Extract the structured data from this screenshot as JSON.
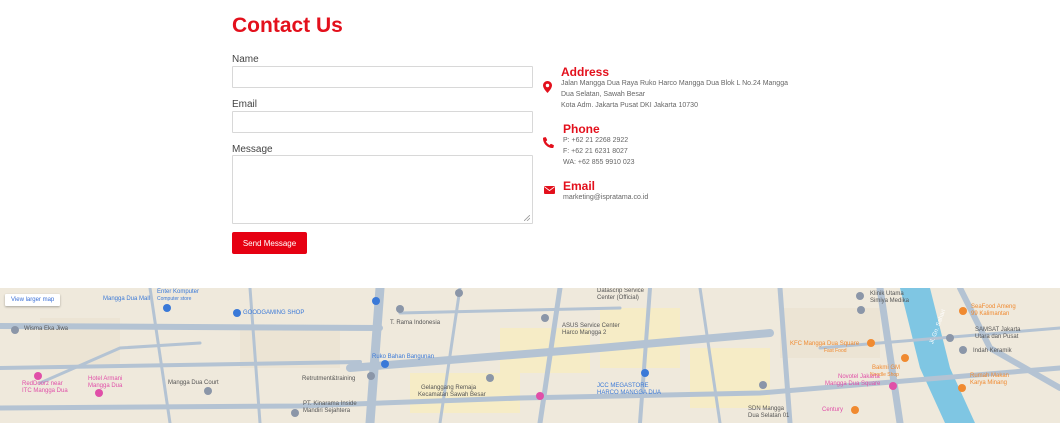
{
  "contact": {
    "title": "Contact Us",
    "name_label": "Name",
    "email_label": "Email",
    "message_label": "Message",
    "send_label": "Send Message"
  },
  "info": {
    "address": {
      "title": "Address",
      "lines": [
        "Jalan Mangga Dua Raya Ruko Harco Mangga Dua Blok L No.24 Mangga",
        "Dua Selatan, Sawah Besar",
        "Kota Adm. Jakarta Pusat DKI Jakarta 10730"
      ],
      "icon": "map-marker-icon"
    },
    "phone": {
      "title": "Phone",
      "lines": [
        "P: +62 21 2268 2922",
        "F: +62 21 6231 8027",
        "WA: +62 855 9910 023"
      ],
      "icon": "phone-icon"
    },
    "email": {
      "title": "Email",
      "lines": [
        "marketing@ispratama.co.id"
      ],
      "icon": "envelope-icon"
    }
  },
  "map": {
    "view_larger": "View larger map",
    "labels": [
      "Mangga Dua Mall",
      "Enter Komputer",
      "Computer store",
      "GOODGAMING SHOP",
      "Wisma Eka Jiwa",
      "T. Rama Indonesia",
      "ASUS Service Center",
      "Harco Mangga 2",
      "Datascrip Service",
      "Center (Official)",
      "Ruko Bahan Bangunan",
      "Retrutment&training",
      "Mangga Dua Court",
      "Hotel Armani",
      "Mangga Dua",
      "RedDoorz near",
      "ITC Mangga Dua",
      "Gelanggang Remaja",
      "Kecamatan Sawah Besar",
      "JCC MEGASTORE",
      "HARCO MANGGA DUA",
      "PT. Kinarama Inside",
      "Mandiri Sejahtera",
      "KFC Mangga Dua Square",
      "Fast Food",
      "Bakmi GM",
      "Noodle Shop",
      "Novotel Jakarta",
      "Mangga Dua Square",
      "Century",
      "SDN Mangga",
      "Dua Selatan 01",
      "Klinik Utama",
      "Simiya Medika",
      "SeaFood Ameng",
      "99 Kalimantan",
      "SAMSAT Jakarta",
      "Utara dan Pusat",
      "Indah Keramik",
      "Rumah Makan",
      "Karya Minang",
      "Jl. Gn. Sahari"
    ],
    "colors": {
      "land": "#efe9dc",
      "road": "#b4c3d3",
      "water": "#7fc6e3",
      "block": "#f6ecc6",
      "pin_blue": "#3a79d8",
      "pin_pink": "#e04fa8",
      "pin_orange": "#f08a30"
    }
  }
}
